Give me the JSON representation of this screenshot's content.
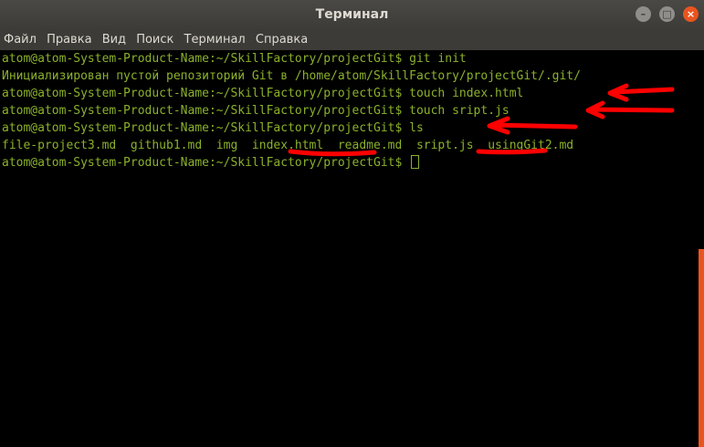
{
  "window": {
    "title": "Терминал"
  },
  "window_buttons": {
    "minimize": "–",
    "maximize": "□",
    "close": "×"
  },
  "menu": [
    "Файл",
    "Правка",
    "Вид",
    "Поиск",
    "Терминал",
    "Справка"
  ],
  "terminal": {
    "lines": [
      "atom@atom-System-Product-Name:~/SkillFactory/projectGit$ git init",
      "Инициализирован пустой репозиторий Git в /home/atom/SkillFactory/projectGit/.git/",
      "atom@atom-System-Product-Name:~/SkillFactory/projectGit$ touch index.html",
      "atom@atom-System-Product-Name:~/SkillFactory/projectGit$ touch sript.js",
      "atom@atom-System-Product-Name:~/SkillFactory/projectGit$ ls",
      "file-project3.md  github1.md  img  index.html  readme.md  sript.js  usingGit2.md"
    ],
    "prompt": "atom@atom-System-Product-Name:~/SkillFactory/projectGit$ "
  },
  "colors": {
    "text": "#8bb12b",
    "annotation": "#ff0000",
    "scroll_thumb": "#e95420"
  }
}
